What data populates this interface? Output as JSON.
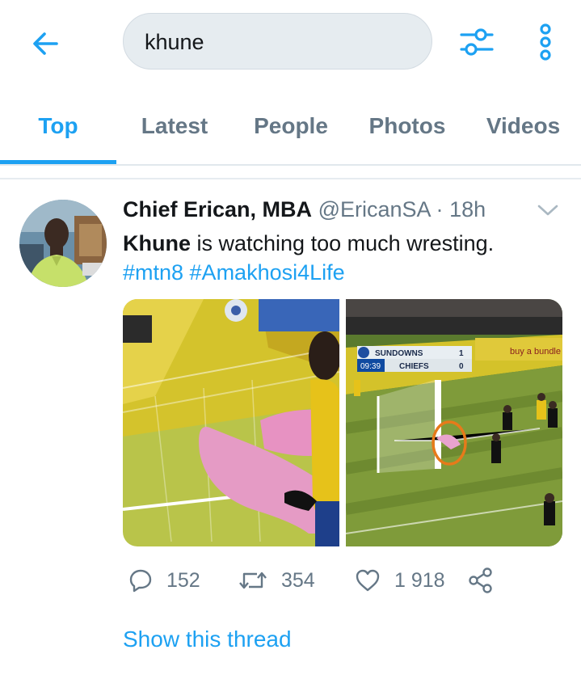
{
  "search": {
    "query": "khune"
  },
  "tabs": [
    {
      "label": "Top"
    },
    {
      "label": "Latest"
    },
    {
      "label": "People"
    },
    {
      "label": "Photos"
    },
    {
      "label": "Videos"
    }
  ],
  "tweet": {
    "name": "Chief Erican, MBA",
    "handle": "@EricanSA",
    "separator": "·",
    "time": "18h",
    "text_keyword": "Khune",
    "text_rest": " is watching too much wresting.",
    "hashtags": "#mtn8 #Amakhosi4Life",
    "scoreboard": {
      "team1": "SUNDOWNS",
      "score1": "1",
      "clock": "09:39",
      "team2": "CHIEFS",
      "score2": "0",
      "banner": "buy a bundle or"
    },
    "replies": "152",
    "retweets": "354",
    "likes": "1 918",
    "show_thread": "Show this thread"
  },
  "colors": {
    "accent": "#1da1f2",
    "muted": "#657786"
  },
  "icons": [
    "back-arrow-icon",
    "filter-icon",
    "more-icon",
    "chevron-down-icon",
    "reply-icon",
    "retweet-icon",
    "like-icon",
    "share-icon"
  ]
}
